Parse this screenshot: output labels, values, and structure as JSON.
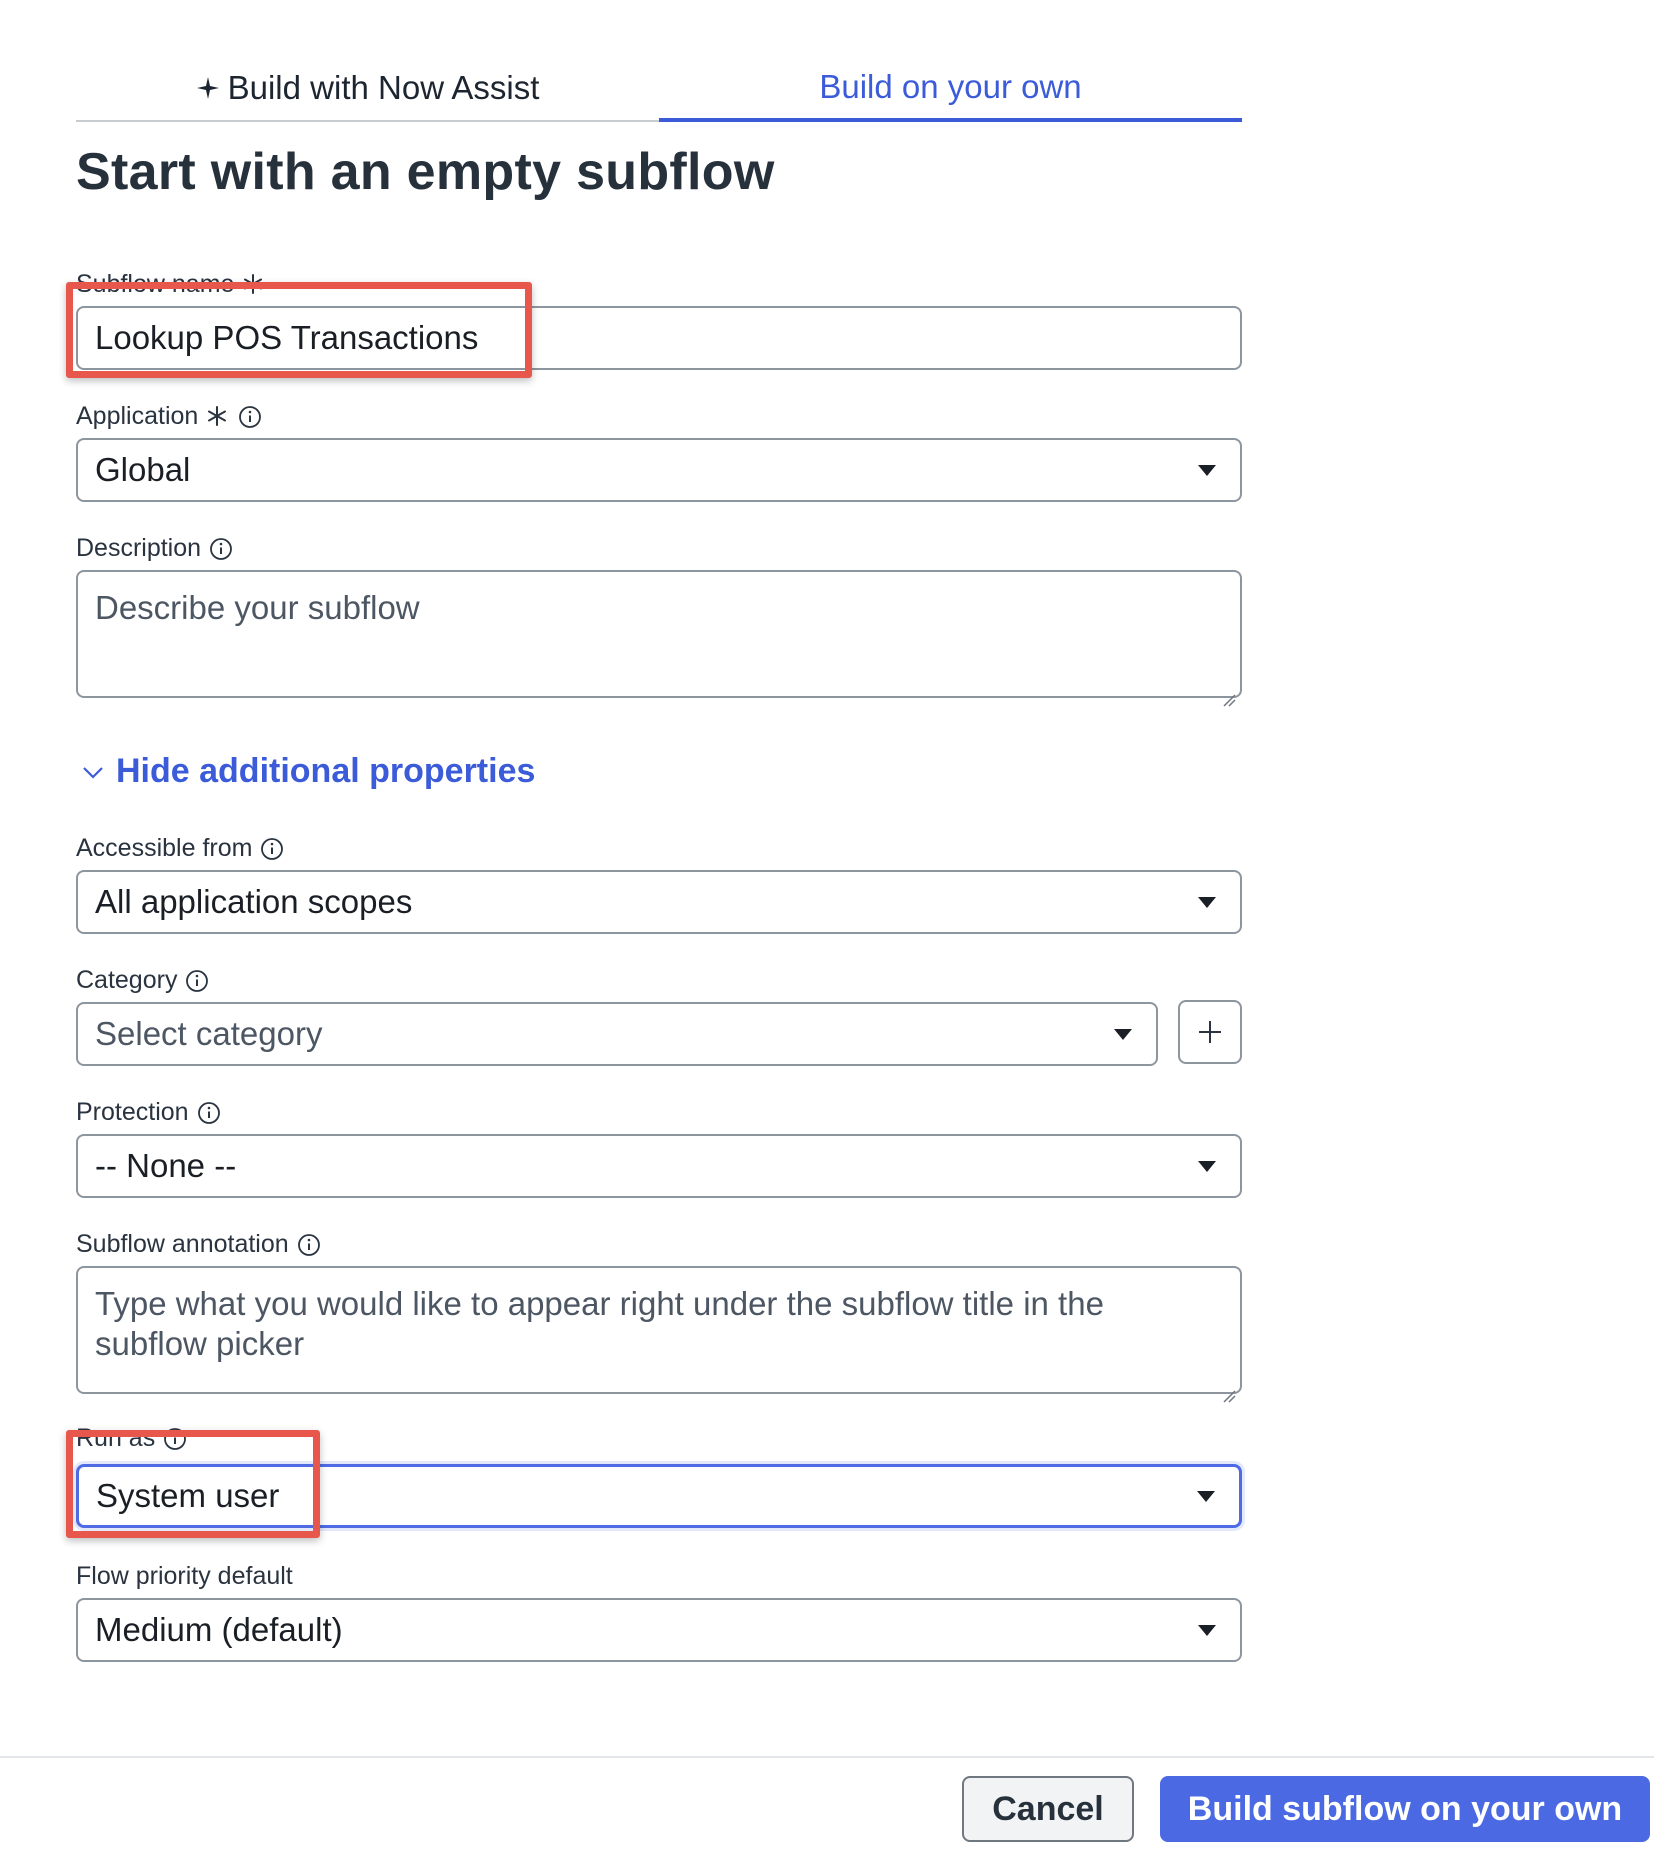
{
  "tabs": [
    {
      "label": "Build with Now Assist",
      "icon": "sparkle-icon",
      "active": false
    },
    {
      "label": "Build on your own",
      "active": true
    }
  ],
  "heading": "Start with an empty subflow",
  "fields": {
    "subflow_name": {
      "label": "Subflow name",
      "value": "Lookup POS Transactions",
      "required": true
    },
    "application": {
      "label": "Application",
      "value": "Global",
      "required": true
    },
    "description": {
      "label": "Description",
      "placeholder": "Describe your subflow"
    },
    "accessible_from": {
      "label": "Accessible from",
      "value": "All application scopes"
    },
    "category": {
      "label": "Category",
      "value": "Select category"
    },
    "protection": {
      "label": "Protection",
      "value": "-- None --"
    },
    "subflow_annotation": {
      "label": "Subflow annotation",
      "placeholder": "Type what you would like to appear right under the subflow title in the subflow picker"
    },
    "run_as": {
      "label": "Run as",
      "value": "System user"
    },
    "flow_priority": {
      "label": "Flow priority default",
      "value": "Medium (default)"
    }
  },
  "toggle": {
    "label": "Hide additional properties",
    "icon": "chevron-down-icon"
  },
  "footer": {
    "cancel_label": "Cancel",
    "primary_label": "Build subflow on your own"
  },
  "colors": {
    "accent": "#3b5bd9",
    "primary_button": "#4a69e2",
    "highlight": "#e8574b"
  }
}
